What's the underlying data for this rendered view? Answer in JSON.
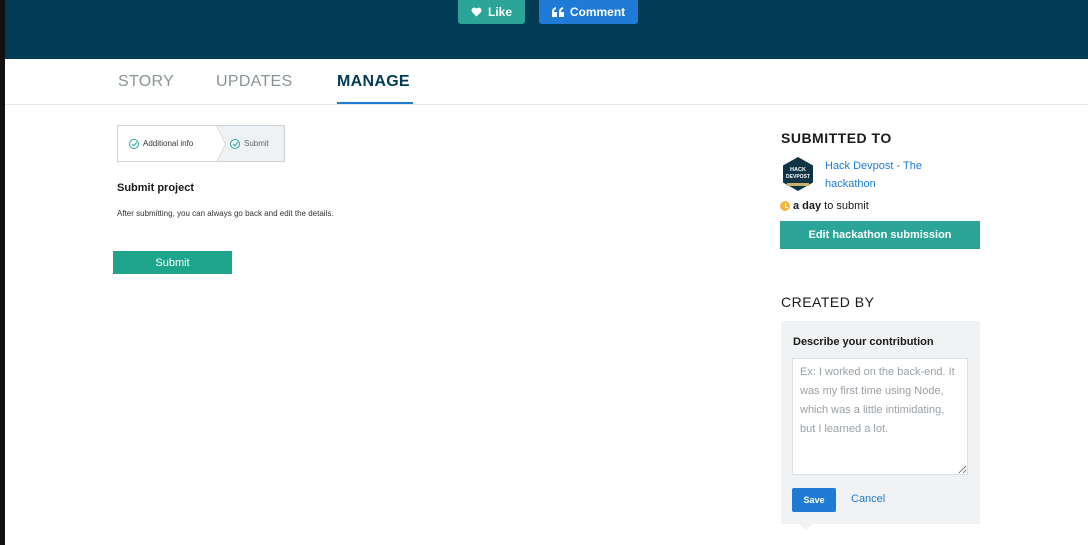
{
  "colors": {
    "hero_bg": "#003d54",
    "like_bg": "#2ba597",
    "comment_bg": "#1f7bd6",
    "primary_green": "#1fa48c",
    "link_blue": "#1f7bd6",
    "deadline_icon": "#f3b73d"
  },
  "hero": {
    "like": {
      "label": "Like",
      "icon": "heart-icon"
    },
    "comment": {
      "label": "Comment",
      "icon": "quote-icon"
    }
  },
  "tabs": [
    {
      "label": "STORY",
      "active": false
    },
    {
      "label": "UPDATES",
      "active": false
    },
    {
      "label": "MANAGE",
      "active": true
    }
  ],
  "stepper": {
    "steps": [
      {
        "label": "Additional info",
        "icon": "check-circle-icon"
      },
      {
        "label": "Submit",
        "icon": "check-circle-icon"
      }
    ]
  },
  "submit_section": {
    "title": "Submit project",
    "description": "After submitting, you can always go back and edit the details.",
    "button_label": "Submit"
  },
  "sidebar": {
    "submitted_heading": "SUBMITTED TO",
    "hackathon": {
      "logo_text": [
        "HACK",
        "DEVPOST"
      ],
      "name": "Hack Devpost - The hackathon"
    },
    "deadline": {
      "icon": "clock-icon",
      "bold": "a day",
      "rest": "to submit"
    },
    "edit_button": "Edit hackathon submission",
    "created_heading": "CREATED BY",
    "contribution": {
      "title": "Describe your contribution",
      "placeholder": "Ex: I worked on the back-end. It was my first time using Node, which was a little intimidating, but I learned a lot.",
      "save_label": "Save",
      "cancel_label": "Cancel"
    }
  }
}
